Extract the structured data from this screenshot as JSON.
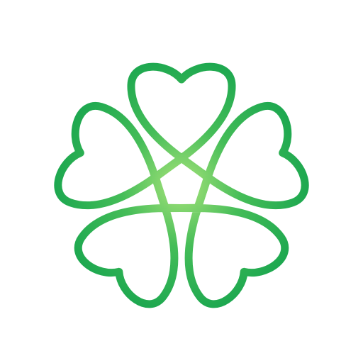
{
  "logo": {
    "icon": "heart-clover-logo-icon",
    "petal_count": 5,
    "colors": {
      "outer": "#1aa64f",
      "mid": "#45bd58",
      "inner": "#a6e37a",
      "background": "#ffffff"
    }
  }
}
